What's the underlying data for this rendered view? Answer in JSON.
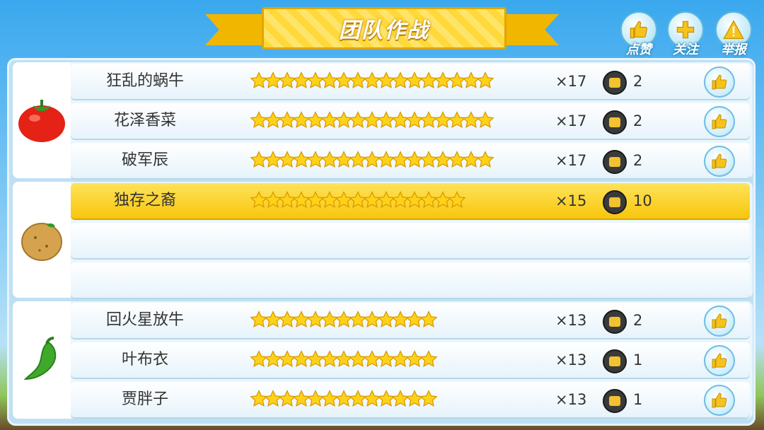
{
  "header": {
    "title": "团队作战"
  },
  "top_buttons": [
    {
      "label": "点赞",
      "icon": "thumbs-up-icon"
    },
    {
      "label": "关注",
      "icon": "plus-icon"
    },
    {
      "label": "举报",
      "icon": "warning-icon"
    }
  ],
  "groups": [
    {
      "icon": "tomato-icon",
      "rows": [
        {
          "name": "狂乱的蜗牛",
          "stars": 17,
          "mult": "×17",
          "count": "2",
          "highlight": false,
          "like": true
        },
        {
          "name": "花泽香菜",
          "stars": 17,
          "mult": "×17",
          "count": "2",
          "highlight": false,
          "like": true
        },
        {
          "name": "破军辰",
          "stars": 17,
          "mult": "×17",
          "count": "2",
          "highlight": false,
          "like": true
        }
      ]
    },
    {
      "icon": "potato-icon",
      "rows": [
        {
          "name": "独存之裔",
          "stars": 15,
          "mult": "×15",
          "count": "10",
          "highlight": true,
          "like": false
        }
      ]
    },
    {
      "icon": "pepper-icon",
      "rows": [
        {
          "name": "回火星放牛",
          "stars": 13,
          "mult": "×13",
          "count": "2",
          "highlight": false,
          "like": true
        },
        {
          "name": "叶布衣",
          "stars": 13,
          "mult": "×13",
          "count": "1",
          "highlight": false,
          "like": true
        },
        {
          "name": "贾胖子",
          "stars": 13,
          "mult": "×13",
          "count": "1",
          "highlight": false,
          "like": true
        }
      ]
    }
  ]
}
